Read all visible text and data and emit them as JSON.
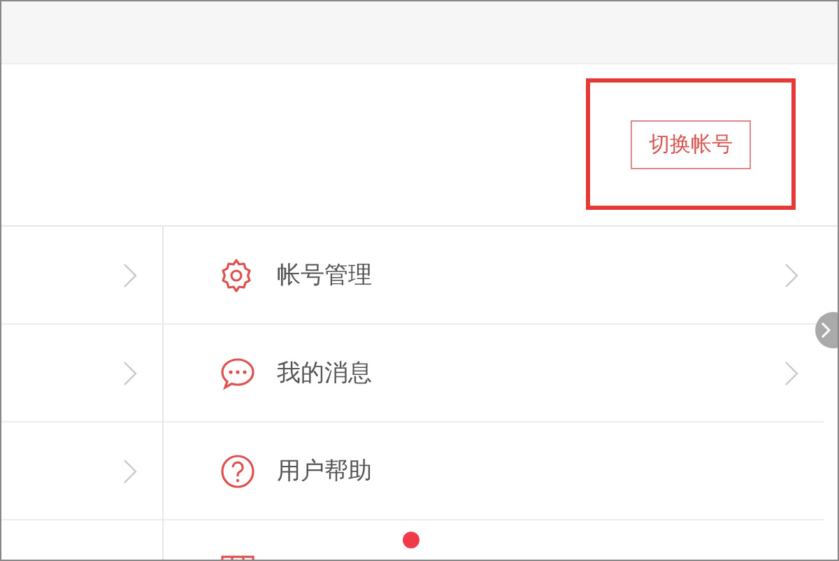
{
  "header": {
    "switch_button": {
      "label": "切换帐号",
      "highlighted": true
    }
  },
  "left_rows": [
    {
      "chevron": true
    },
    {
      "chevron": true
    },
    {
      "chevron": true
    }
  ],
  "menu": [
    {
      "kind": "gear",
      "label": "帐号管理",
      "chevron": true,
      "badge": false
    },
    {
      "kind": "chat",
      "label": "我的消息",
      "chevron": true,
      "badge": false
    },
    {
      "kind": "help",
      "label": "用户帮助",
      "chevron": false,
      "badge": false
    },
    {
      "kind": "grid",
      "chevron": false,
      "badge": true
    }
  ]
}
